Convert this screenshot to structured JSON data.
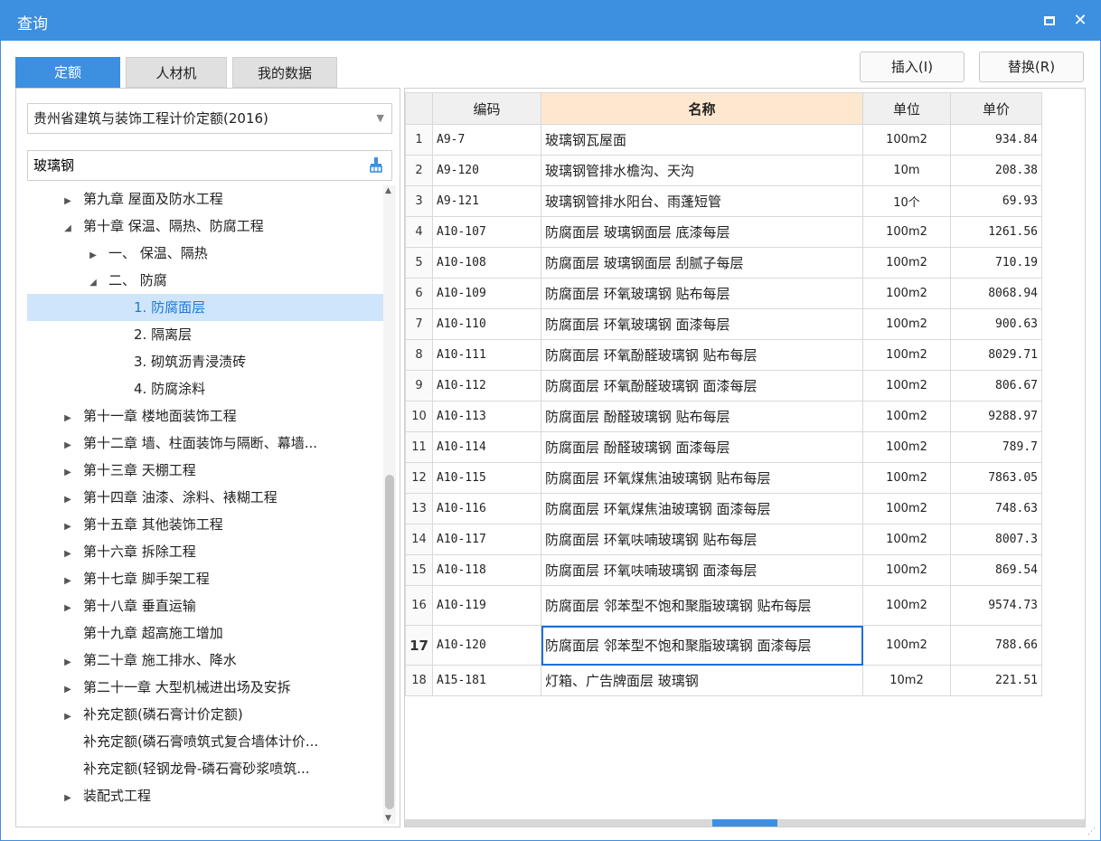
{
  "window": {
    "title": "查询"
  },
  "tabs": [
    {
      "label": "定额",
      "active": true
    },
    {
      "label": "人材机",
      "active": false
    },
    {
      "label": "我的数据",
      "active": false
    }
  ],
  "actions": {
    "insert_label": "插入(I)",
    "replace_label": "替换(R)"
  },
  "left": {
    "quota_library": "贵州省建筑与装饰工程计价定额(2016)",
    "search_value": "玻璃钢",
    "tree": [
      {
        "label": "第九章 屋面及防水工程",
        "level": 0,
        "toggle": "▶"
      },
      {
        "label": "第十章 保温、隔热、防腐工程",
        "level": 0,
        "toggle": "◢"
      },
      {
        "label": "一、 保温、隔热",
        "level": 1,
        "toggle": "▶"
      },
      {
        "label": "二、 防腐",
        "level": 1,
        "toggle": "◢"
      },
      {
        "label": "1. 防腐面层",
        "level": 2,
        "toggle": "",
        "selected": true
      },
      {
        "label": "2. 隔离层",
        "level": 2,
        "toggle": ""
      },
      {
        "label": "3. 砌筑沥青浸渍砖",
        "level": 2,
        "toggle": ""
      },
      {
        "label": "4. 防腐涂料",
        "level": 2,
        "toggle": ""
      },
      {
        "label": "第十一章 楼地面装饰工程",
        "level": 0,
        "toggle": "▶"
      },
      {
        "label": "第十二章 墙、柱面装饰与隔断、幕墙...",
        "level": 0,
        "toggle": "▶"
      },
      {
        "label": "第十三章 天棚工程",
        "level": 0,
        "toggle": "▶"
      },
      {
        "label": "第十四章 油漆、涂料、裱糊工程",
        "level": 0,
        "toggle": "▶"
      },
      {
        "label": "第十五章 其他装饰工程",
        "level": 0,
        "toggle": "▶"
      },
      {
        "label": "第十六章 拆除工程",
        "level": 0,
        "toggle": "▶"
      },
      {
        "label": "第十七章 脚手架工程",
        "level": 0,
        "toggle": "▶"
      },
      {
        "label": "第十八章 垂直运输",
        "level": 0,
        "toggle": "▶"
      },
      {
        "label": "第十九章 超高施工增加",
        "level": 0,
        "toggle": ""
      },
      {
        "label": "第二十章 施工排水、降水",
        "level": 0,
        "toggle": "▶"
      },
      {
        "label": "第二十一章 大型机械进出场及安拆",
        "level": 0,
        "toggle": "▶"
      },
      {
        "label": "补充定额(磷石膏计价定额)",
        "level": 0,
        "toggle": "▶"
      },
      {
        "label": "补充定额(磷石膏喷筑式复合墙体计价...",
        "level": 0,
        "toggle": ""
      },
      {
        "label": "补充定额(轻钢龙骨-磷石膏砂浆喷筑...",
        "level": 0,
        "toggle": ""
      },
      {
        "label": "装配式工程",
        "level": 0,
        "toggle": "▶"
      }
    ]
  },
  "table": {
    "headers": {
      "code": "编码",
      "name": "名称",
      "unit": "单位",
      "price": "单价"
    },
    "rows": [
      {
        "idx": "1",
        "code": "A9-7",
        "name": "玻璃钢瓦屋面",
        "unit": "100m2",
        "price": "934.84"
      },
      {
        "idx": "2",
        "code": "A9-120",
        "name": "玻璃钢管排水檐沟、天沟",
        "unit": "10m",
        "price": "208.38"
      },
      {
        "idx": "3",
        "code": "A9-121",
        "name": "玻璃钢管排水阳台、雨蓬短管",
        "unit": "10个",
        "price": "69.93"
      },
      {
        "idx": "4",
        "code": "A10-107",
        "name": "防腐面层 玻璃钢面层 底漆每层",
        "unit": "100m2",
        "price": "1261.56"
      },
      {
        "idx": "5",
        "code": "A10-108",
        "name": "防腐面层 玻璃钢面层 刮腻子每层",
        "unit": "100m2",
        "price": "710.19"
      },
      {
        "idx": "6",
        "code": "A10-109",
        "name": "防腐面层 环氧玻璃钢 贴布每层",
        "unit": "100m2",
        "price": "8068.94"
      },
      {
        "idx": "7",
        "code": "A10-110",
        "name": "防腐面层 环氧玻璃钢 面漆每层",
        "unit": "100m2",
        "price": "900.63"
      },
      {
        "idx": "8",
        "code": "A10-111",
        "name": "防腐面层 环氧酚醛玻璃钢 贴布每层",
        "unit": "100m2",
        "price": "8029.71"
      },
      {
        "idx": "9",
        "code": "A10-112",
        "name": "防腐面层 环氧酚醛玻璃钢 面漆每层",
        "unit": "100m2",
        "price": "806.67"
      },
      {
        "idx": "10",
        "code": "A10-113",
        "name": "防腐面层 酚醛玻璃钢 贴布每层",
        "unit": "100m2",
        "price": "9288.97"
      },
      {
        "idx": "11",
        "code": "A10-114",
        "name": "防腐面层 酚醛玻璃钢 面漆每层",
        "unit": "100m2",
        "price": "789.7"
      },
      {
        "idx": "12",
        "code": "A10-115",
        "name": "防腐面层 环氧煤焦油玻璃钢 贴布每层",
        "unit": "100m2",
        "price": "7863.05"
      },
      {
        "idx": "13",
        "code": "A10-116",
        "name": "防腐面层 环氧煤焦油玻璃钢 面漆每层",
        "unit": "100m2",
        "price": "748.63"
      },
      {
        "idx": "14",
        "code": "A10-117",
        "name": "防腐面层 环氧呋喃玻璃钢 贴布每层",
        "unit": "100m2",
        "price": "8007.3"
      },
      {
        "idx": "15",
        "code": "A10-118",
        "name": "防腐面层 环氧呋喃玻璃钢 面漆每层",
        "unit": "100m2",
        "price": "869.54"
      },
      {
        "idx": "16",
        "code": "A10-119",
        "name": "防腐面层 邻苯型不饱和聚脂玻璃钢 贴布每层",
        "unit": "100m2",
        "price": "9574.73"
      },
      {
        "idx": "17",
        "code": "A10-120",
        "name": "防腐面层 邻苯型不饱和聚脂玻璃钢 面漆每层",
        "unit": "100m2",
        "price": "788.66",
        "current": true
      },
      {
        "idx": "18",
        "code": "A15-181",
        "name": "灯箱、广告牌面层 玻璃钢",
        "unit": "10m2",
        "price": "221.51"
      }
    ]
  },
  "colors": {
    "accent": "#3d8fe0",
    "selected_tree_bg": "#cfe5fb",
    "header_highlight": "#fde8cf"
  }
}
